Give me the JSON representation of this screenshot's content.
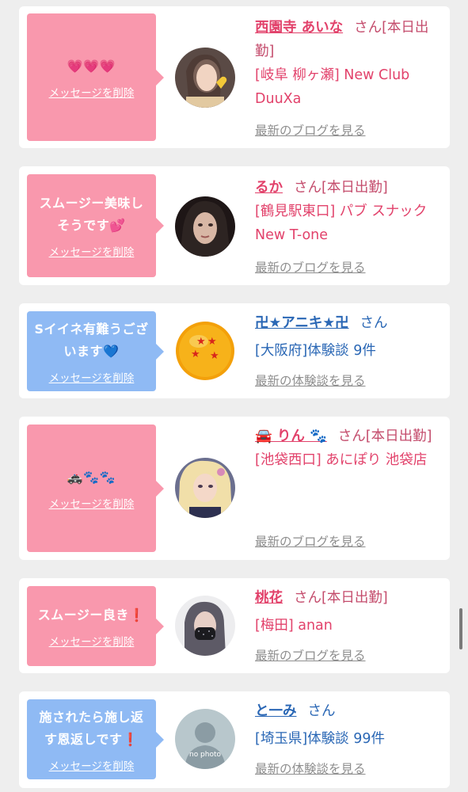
{
  "common": {
    "delete_label": "メッセージを削除",
    "honorific": "さん"
  },
  "messages": [
    {
      "bubble_text": "💗💗💗",
      "bubble_color": "#f998ad",
      "name": "西園寺 あいな",
      "status": "[本日出勤]",
      "shop": "[岐阜 柳ヶ瀬] New Club DuuXa",
      "link": "最新のブログを見る"
    },
    {
      "bubble_text": "スムージー美味しそうです💕",
      "bubble_color": "#f998ad",
      "name": "るか",
      "status": "[本日出勤]",
      "shop": "[鶴見駅東口] パブ スナック New T-one",
      "link": "最新のブログを見る"
    },
    {
      "bubble_text": "Sイイネ有難うございます💙",
      "bubble_color": "#8fbaf4",
      "name": "卍★アニキ★卍",
      "status": "",
      "shop": "[大阪府]体験談 9件",
      "link": "最新の体験談を見る"
    },
    {
      "bubble_text": "🚓🐾🐾",
      "bubble_color": "#f998ad",
      "name": "🚘 りん 🐾",
      "status": "[本日出勤]",
      "shop": "[池袋西口] あにぽり 池袋店",
      "link": "最新のブログを見る"
    },
    {
      "bubble_text": "スムージー良き❗️",
      "bubble_color": "#f998ad",
      "name": "桃花",
      "status": "[本日出勤]",
      "shop": "[梅田] anan",
      "link": "最新のブログを見る"
    },
    {
      "bubble_text": "施されたら施し返す恩返しです❗️",
      "bubble_color": "#8fbaf4",
      "name": "と一み",
      "status": "",
      "shop": "[埼玉県]体験談 99件",
      "link": "最新の体験談を見る",
      "avatar_text": "no photo"
    }
  ]
}
